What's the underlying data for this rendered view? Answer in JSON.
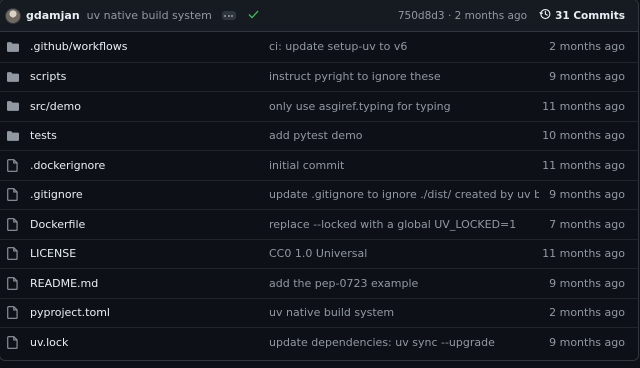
{
  "header": {
    "author": "gdamjan",
    "message": "uv native build system",
    "sha_age": "750d8d3 · 2 months ago",
    "commits_count": "31 Commits",
    "status_color": "#3fb950"
  },
  "files": [
    {
      "type": "folder",
      "name": ".github/workflows",
      "message": "ci: update setup-uv to v6",
      "age": "2 months ago"
    },
    {
      "type": "folder",
      "name": "scripts",
      "message": "instruct pyright to ignore these",
      "age": "9 months ago"
    },
    {
      "type": "folder",
      "name": "src/demo",
      "message": "only use asgiref.typing for typing",
      "age": "11 months ago"
    },
    {
      "type": "folder",
      "name": "tests",
      "message": "add pytest demo",
      "age": "10 months ago"
    },
    {
      "type": "file",
      "name": ".dockerignore",
      "message": "initial commit",
      "age": "11 months ago"
    },
    {
      "type": "file",
      "name": ".gitignore",
      "message": "update .gitignore to ignore ./dist/ created by uv build",
      "age": "9 months ago"
    },
    {
      "type": "file",
      "name": "Dockerfile",
      "message": "replace --locked with a global UV_LOCKED=1",
      "age": "7 months ago"
    },
    {
      "type": "file",
      "name": "LICENSE",
      "message": "CC0 1.0 Universal",
      "age": "11 months ago"
    },
    {
      "type": "file",
      "name": "README.md",
      "message": "add the pep-0723 example",
      "age": "9 months ago"
    },
    {
      "type": "file",
      "name": "pyproject.toml",
      "message": "uv native build system",
      "age": "2 months ago"
    },
    {
      "type": "file",
      "name": "uv.lock",
      "message": "update dependencies: uv sync --upgrade",
      "age": "9 months ago"
    }
  ]
}
